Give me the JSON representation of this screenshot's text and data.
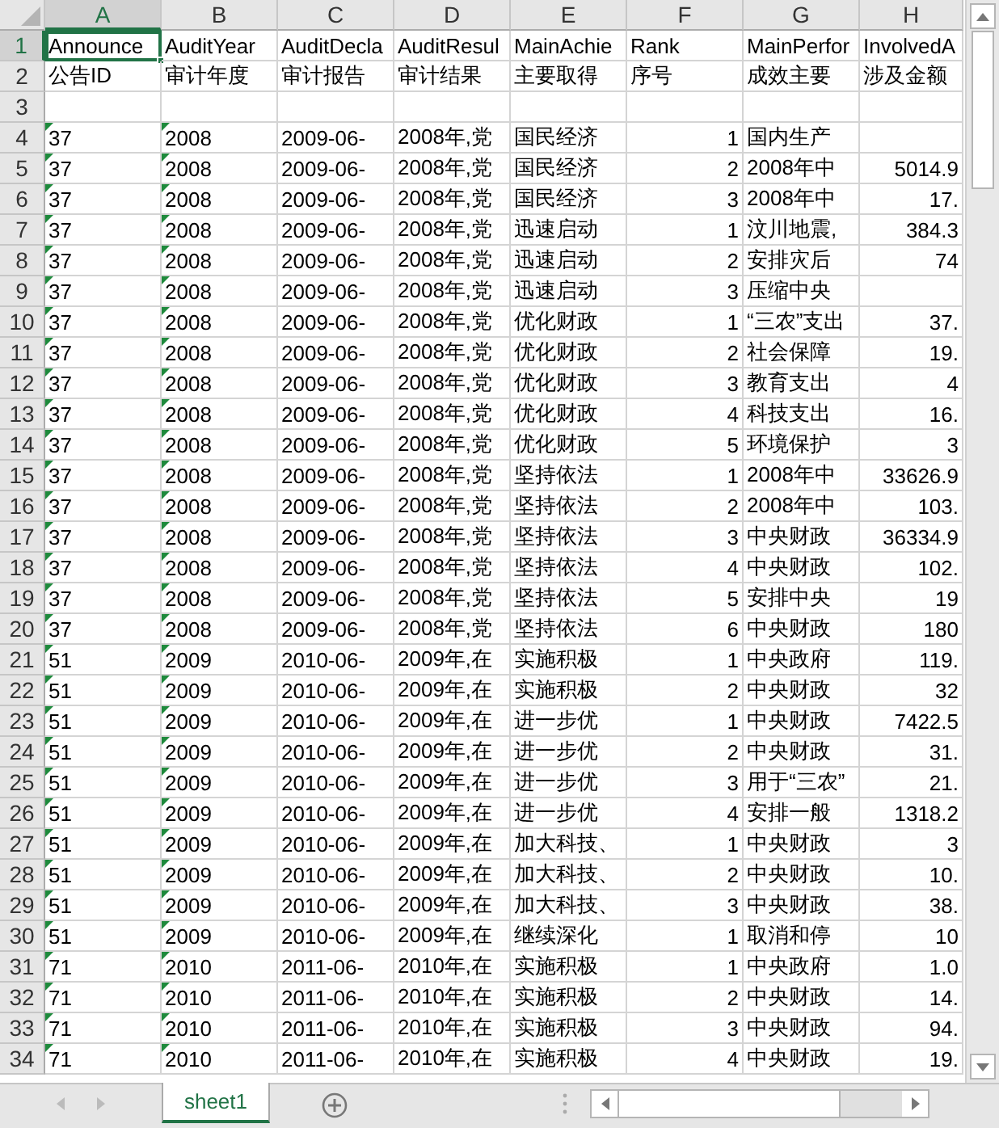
{
  "columns": [
    {
      "letter": "A",
      "selected": true,
      "kind": "text"
    },
    {
      "letter": "B",
      "selected": false,
      "kind": "text"
    },
    {
      "letter": "C",
      "selected": false,
      "kind": "text"
    },
    {
      "letter": "D",
      "selected": false,
      "kind": "text"
    },
    {
      "letter": "E",
      "selected": false,
      "kind": "text"
    },
    {
      "letter": "F",
      "selected": false,
      "kind": "number"
    },
    {
      "letter": "G",
      "selected": false,
      "kind": "text"
    },
    {
      "letter": "H",
      "selected": false,
      "kind": "number"
    }
  ],
  "rows": [
    {
      "number": "1",
      "selected": true,
      "kind": "label",
      "cells": [
        "Announce",
        "AuditYear",
        "AuditDecla",
        "AuditResul",
        "MainAchie",
        "Rank",
        "MainPerfor",
        "InvolvedA"
      ]
    },
    {
      "number": "2",
      "selected": false,
      "kind": "label",
      "cells": [
        "公告ID",
        "审计年度",
        "审计报告",
        "审计结果",
        "主要取得",
        "序号",
        "成效主要",
        "涉及金额"
      ]
    },
    {
      "number": "3",
      "selected": false,
      "kind": "blank"
    },
    {
      "number": "4",
      "selected": false,
      "flagged": true,
      "cells": [
        "37",
        "2008",
        "2009-06-",
        "2008年,党",
        "国民经济",
        "1",
        "国内生产",
        null
      ]
    },
    {
      "number": "5",
      "selected": false,
      "flagged": true,
      "cells": [
        "37",
        "2008",
        "2009-06-",
        "2008年,党",
        "国民经济",
        "2",
        "2008年中",
        "5014.9"
      ]
    },
    {
      "number": "6",
      "selected": false,
      "flagged": true,
      "cells": [
        "37",
        "2008",
        "2009-06-",
        "2008年,党",
        "国民经济",
        "3",
        "2008年中",
        "17."
      ]
    },
    {
      "number": "7",
      "selected": false,
      "flagged": true,
      "cells": [
        "37",
        "2008",
        "2009-06-",
        "2008年,党",
        "迅速启动",
        "1",
        "汶川地震,",
        "384.3"
      ]
    },
    {
      "number": "8",
      "selected": false,
      "flagged": true,
      "cells": [
        "37",
        "2008",
        "2009-06-",
        "2008年,党",
        "迅速启动",
        "2",
        "安排灾后",
        "74"
      ]
    },
    {
      "number": "9",
      "selected": false,
      "flagged": true,
      "cells": [
        "37",
        "2008",
        "2009-06-",
        "2008年,党",
        "迅速启动",
        "3",
        "压缩中央",
        null
      ]
    },
    {
      "number": "10",
      "selected": false,
      "flagged": true,
      "cells": [
        "37",
        "2008",
        "2009-06-",
        "2008年,党",
        "优化财政",
        "1",
        "“三农”支出",
        "37."
      ]
    },
    {
      "number": "11",
      "selected": false,
      "flagged": true,
      "cells": [
        "37",
        "2008",
        "2009-06-",
        "2008年,党",
        "优化财政",
        "2",
        "社会保障",
        "19."
      ]
    },
    {
      "number": "12",
      "selected": false,
      "flagged": true,
      "cells": [
        "37",
        "2008",
        "2009-06-",
        "2008年,党",
        "优化财政",
        "3",
        "教育支出",
        "4"
      ]
    },
    {
      "number": "13",
      "selected": false,
      "flagged": true,
      "cells": [
        "37",
        "2008",
        "2009-06-",
        "2008年,党",
        "优化财政",
        "4",
        "科技支出",
        "16."
      ]
    },
    {
      "number": "14",
      "selected": false,
      "flagged": true,
      "cells": [
        "37",
        "2008",
        "2009-06-",
        "2008年,党",
        "优化财政",
        "5",
        "环境保护",
        "3"
      ]
    },
    {
      "number": "15",
      "selected": false,
      "flagged": true,
      "cells": [
        "37",
        "2008",
        "2009-06-",
        "2008年,党",
        "坚持依法",
        "1",
        "2008年中",
        "33626.9"
      ]
    },
    {
      "number": "16",
      "selected": false,
      "flagged": true,
      "cells": [
        "37",
        "2008",
        "2009-06-",
        "2008年,党",
        "坚持依法",
        "2",
        "2008年中",
        "103."
      ]
    },
    {
      "number": "17",
      "selected": false,
      "flagged": true,
      "cells": [
        "37",
        "2008",
        "2009-06-",
        "2008年,党",
        "坚持依法",
        "3",
        "中央财政",
        "36334.9"
      ]
    },
    {
      "number": "18",
      "selected": false,
      "flagged": true,
      "cells": [
        "37",
        "2008",
        "2009-06-",
        "2008年,党",
        "坚持依法",
        "4",
        "中央财政",
        "102."
      ]
    },
    {
      "number": "19",
      "selected": false,
      "flagged": true,
      "cells": [
        "37",
        "2008",
        "2009-06-",
        "2008年,党",
        "坚持依法",
        "5",
        "安排中央",
        "19"
      ]
    },
    {
      "number": "20",
      "selected": false,
      "flagged": true,
      "cells": [
        "37",
        "2008",
        "2009-06-",
        "2008年,党",
        "坚持依法",
        "6",
        "中央财政",
        "180"
      ]
    },
    {
      "number": "21",
      "selected": false,
      "flagged": true,
      "cells": [
        "51",
        "2009",
        "2010-06-",
        "2009年,在",
        "实施积极",
        "1",
        "中央政府",
        "119."
      ]
    },
    {
      "number": "22",
      "selected": false,
      "flagged": true,
      "cells": [
        "51",
        "2009",
        "2010-06-",
        "2009年,在",
        "实施积极",
        "2",
        "中央财政",
        "32"
      ]
    },
    {
      "number": "23",
      "selected": false,
      "flagged": true,
      "cells": [
        "51",
        "2009",
        "2010-06-",
        "2009年,在",
        "进一步优",
        "1",
        "中央财政",
        "7422.5"
      ]
    },
    {
      "number": "24",
      "selected": false,
      "flagged": true,
      "cells": [
        "51",
        "2009",
        "2010-06-",
        "2009年,在",
        "进一步优",
        "2",
        "中央财政",
        "31."
      ]
    },
    {
      "number": "25",
      "selected": false,
      "flagged": true,
      "cells": [
        "51",
        "2009",
        "2010-06-",
        "2009年,在",
        "进一步优",
        "3",
        "用于“三农”",
        "21."
      ]
    },
    {
      "number": "26",
      "selected": false,
      "flagged": true,
      "cells": [
        "51",
        "2009",
        "2010-06-",
        "2009年,在",
        "进一步优",
        "4",
        "安排一般",
        "1318.2"
      ]
    },
    {
      "number": "27",
      "selected": false,
      "flagged": true,
      "cells": [
        "51",
        "2009",
        "2010-06-",
        "2009年,在",
        "加大科技、",
        "1",
        "中央财政",
        "3"
      ]
    },
    {
      "number": "28",
      "selected": false,
      "flagged": true,
      "cells": [
        "51",
        "2009",
        "2010-06-",
        "2009年,在",
        "加大科技、",
        "2",
        "中央财政",
        "10."
      ]
    },
    {
      "number": "29",
      "selected": false,
      "flagged": true,
      "cells": [
        "51",
        "2009",
        "2010-06-",
        "2009年,在",
        "加大科技、",
        "3",
        "中央财政",
        "38."
      ]
    },
    {
      "number": "30",
      "selected": false,
      "flagged": true,
      "cells": [
        "51",
        "2009",
        "2010-06-",
        "2009年,在",
        "继续深化",
        "1",
        "取消和停",
        "10"
      ]
    },
    {
      "number": "31",
      "selected": false,
      "flagged": true,
      "cells": [
        "71",
        "2010",
        "2011-06-",
        "2010年,在",
        "实施积极",
        "1",
        "中央政府",
        "1.0"
      ]
    },
    {
      "number": "32",
      "selected": false,
      "flagged": true,
      "cells": [
        "71",
        "2010",
        "2011-06-",
        "2010年,在",
        "实施积极",
        "2",
        "中央财政",
        "14."
      ]
    },
    {
      "number": "33",
      "selected": false,
      "flagged": true,
      "cells": [
        "71",
        "2010",
        "2011-06-",
        "2010年,在",
        "实施积极",
        "3",
        "中央财政",
        "94."
      ]
    },
    {
      "number": "34",
      "selected": false,
      "flagged": true,
      "cells": [
        "71",
        "2010",
        "2011-06-",
        "2010年,在",
        "实施积极",
        "4",
        "中央财政",
        "19."
      ]
    }
  ],
  "sheet_tabs": [
    {
      "label": "sheet1",
      "selected": true
    }
  ]
}
